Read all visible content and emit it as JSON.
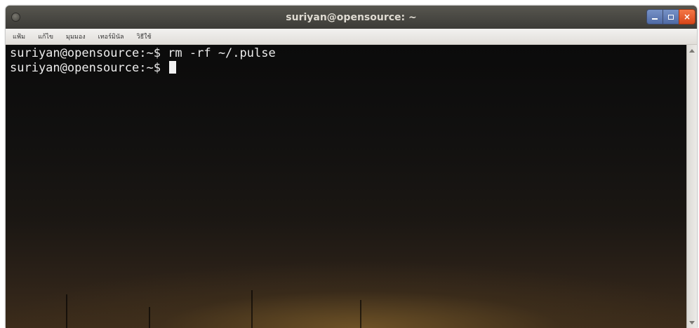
{
  "window": {
    "title": "suriyan@opensource: ~",
    "controls": {
      "minimize": "minimize-icon",
      "maximize": "maximize-icon",
      "close": "×"
    }
  },
  "menubar": {
    "items": [
      {
        "label": "แฟ้ม"
      },
      {
        "label": "แก้ไข"
      },
      {
        "label": "มุมมอง"
      },
      {
        "label": "เทอร์มินัล"
      },
      {
        "label": "วิธีใช้"
      }
    ]
  },
  "terminal": {
    "lines": [
      {
        "prompt": "suriyan@opensource:~$",
        "command": " rm -rf ~/.pulse"
      },
      {
        "prompt": "suriyan@opensource:~$",
        "command": " "
      }
    ],
    "colors": {
      "text": "#ececec",
      "background": "#121110",
      "glow": "#765828"
    }
  },
  "scrollbar": {
    "icons": [
      "arrow-up-icon",
      "arrow-down-icon"
    ]
  }
}
